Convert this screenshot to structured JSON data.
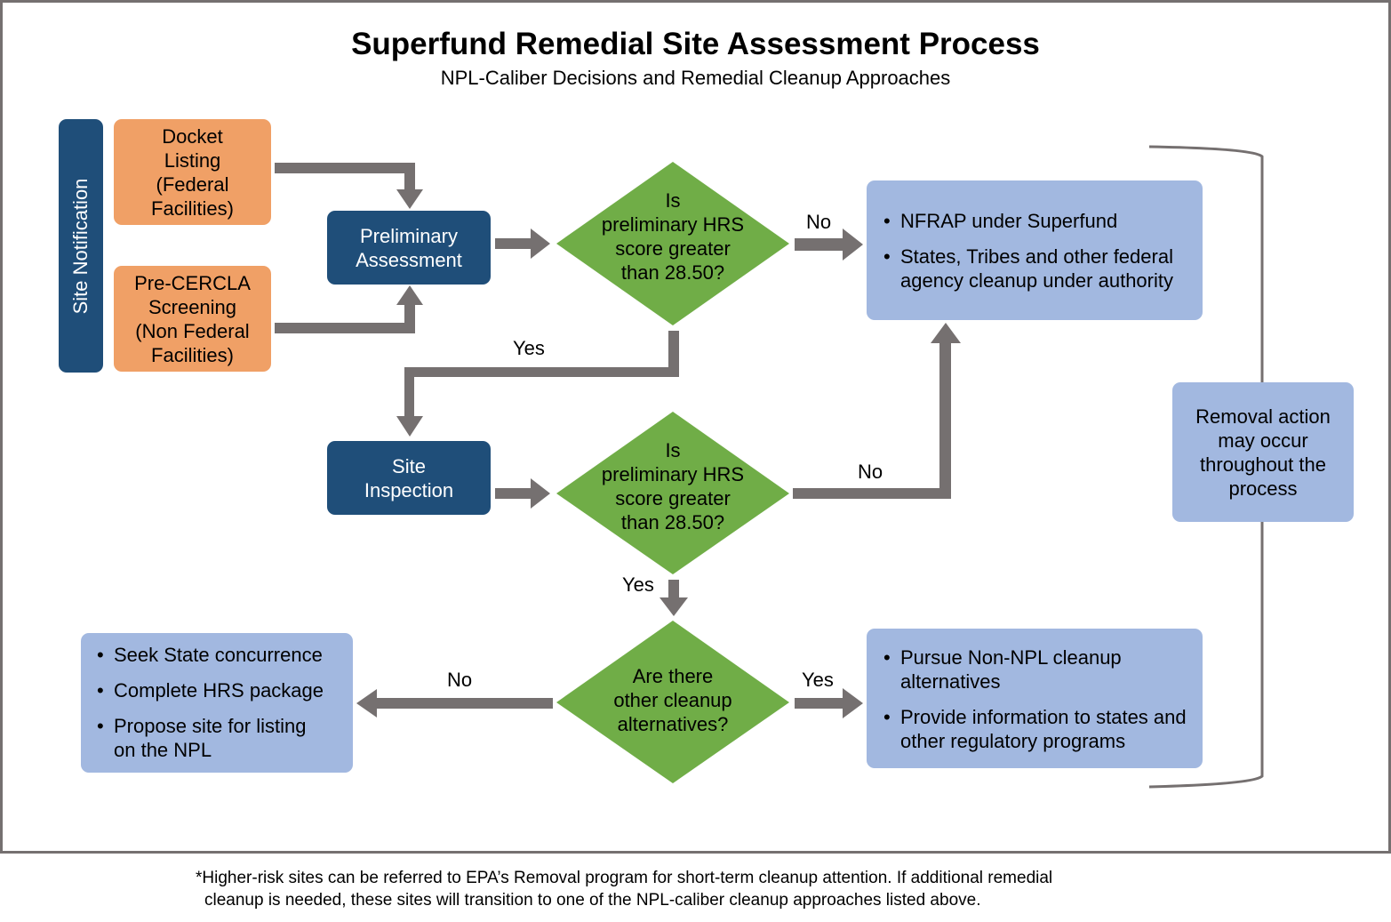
{
  "title": "Superfund Remedial Site Assessment Process",
  "subtitle": "NPL-Caliber Decisions and Remedial Cleanup Approaches",
  "colors": {
    "navy": "#1f4e79",
    "orange": "#f0a066",
    "green": "#70ad47",
    "light_blue": "#a2b8e0",
    "arrow_gray": "#757070"
  },
  "side_label": "Site Notification",
  "sources": [
    {
      "lines": [
        "Docket",
        "Listing",
        "(Federal",
        "Facilities)"
      ]
    },
    {
      "lines": [
        "Pre-CERCLA",
        "Screening",
        "(Non Federal",
        "Facilities)"
      ]
    }
  ],
  "steps": {
    "preliminary_assessment": [
      "Preliminary",
      "Assessment"
    ],
    "site_inspection": [
      "Site",
      "Inspection"
    ]
  },
  "decisions": {
    "pa_decision": [
      "Is",
      "preliminary HRS",
      "score greater",
      "than 28.50?"
    ],
    "si_decision": [
      "Is",
      "preliminary HRS",
      "score greater",
      "than 28.50?"
    ],
    "alternatives_decision": [
      "Are there",
      "other cleanup",
      "alternatives?"
    ]
  },
  "edge_labels": {
    "pa_no": "No",
    "pa_yes": "Yes",
    "si_no": "No",
    "si_yes": "Yes",
    "alt_no": "No",
    "alt_yes": "Yes"
  },
  "outcomes": {
    "nfrap": [
      "NFRAP under Superfund",
      "States, Tribes and other federal agency cleanup under authority"
    ],
    "npl_listing": [
      "Seek State concurrence",
      "Complete HRS package",
      "Propose site for listing on the NPL"
    ],
    "non_npl": [
      "Pursue Non-NPL cleanup alternatives",
      "Provide information to states and other regulatory programs"
    ]
  },
  "removal_note": [
    "Removal action",
    "may occur",
    "throughout the",
    "process"
  ],
  "footnote": [
    "*Higher-risk sites can be referred to EPA’s Removal program for short-term cleanup attention. If additional remedial",
    "cleanup is needed, these sites will transition to one of the NPL-caliber cleanup approaches listed above."
  ]
}
